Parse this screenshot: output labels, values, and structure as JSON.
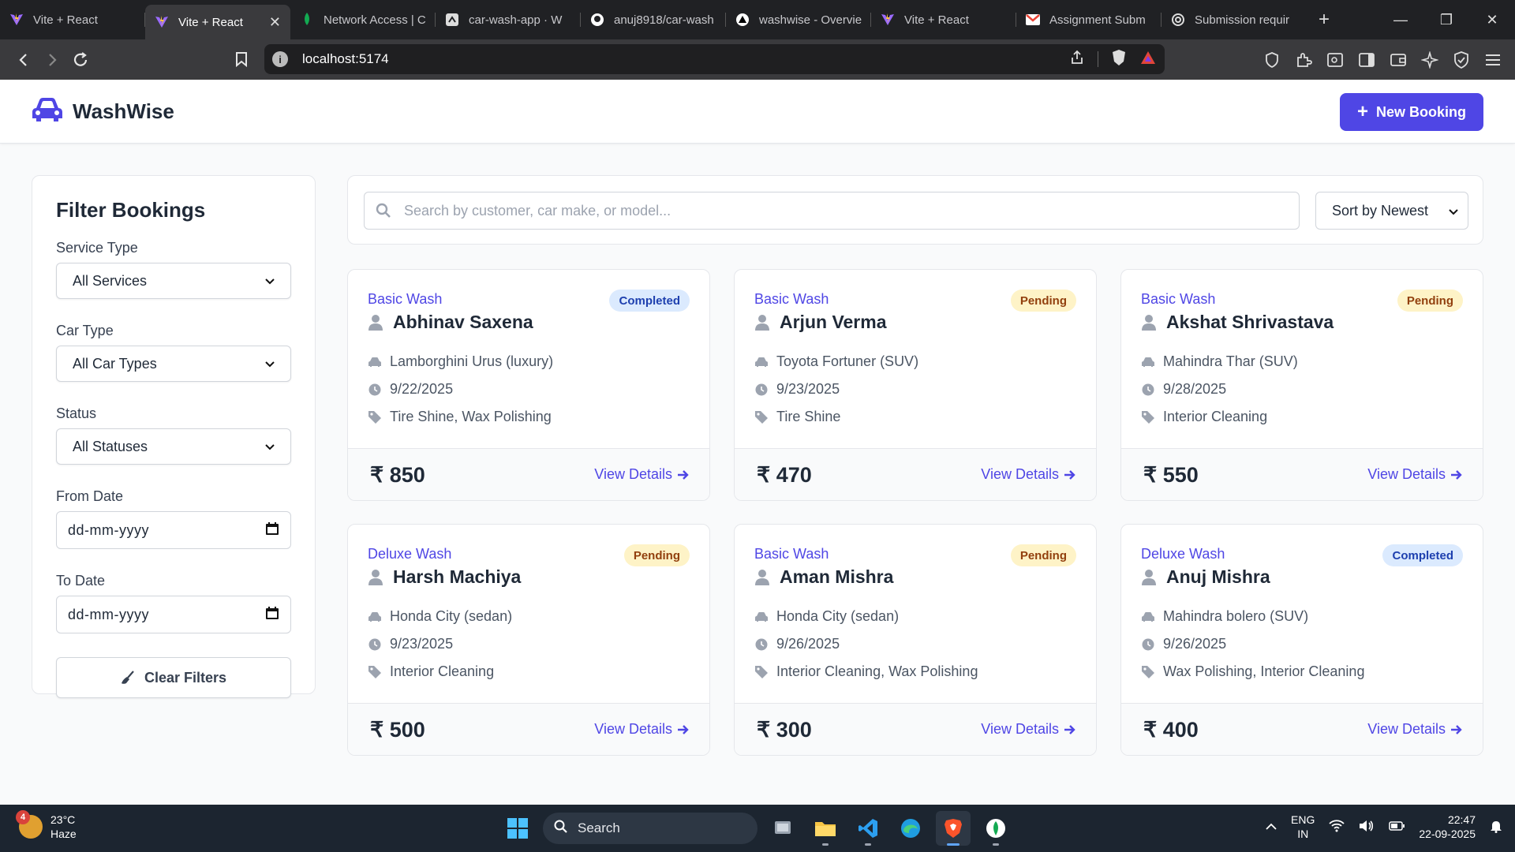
{
  "browser": {
    "tabs": [
      {
        "title": "Vite + React",
        "favicon": "vite-icon",
        "active": false
      },
      {
        "title": "Vite + React",
        "favicon": "vite-icon",
        "active": true
      },
      {
        "title": "Network Access | C",
        "favicon": "mongodb-leaf-icon",
        "active": false
      },
      {
        "title": "car-wash-app · W",
        "favicon": "render-icon",
        "active": false
      },
      {
        "title": "anuj8918/car-wash",
        "favicon": "github-icon",
        "active": false
      },
      {
        "title": "washwise - Overvie",
        "favicon": "vercel-icon",
        "active": false
      },
      {
        "title": "Vite + React",
        "favicon": "vite-icon",
        "active": false
      },
      {
        "title": "Assignment Subm",
        "favicon": "gmail-icon",
        "active": false
      },
      {
        "title": "Submission requir",
        "favicon": "chatgpt-icon",
        "active": false
      }
    ],
    "url": "localhost:5174"
  },
  "app": {
    "name": "WashWise",
    "new_booking_label": "New Booking",
    "accent": "#4f46e5"
  },
  "filters": {
    "title": "Filter Bookings",
    "service_type": {
      "label": "Service Type",
      "value": "All Services"
    },
    "car_type": {
      "label": "Car Type",
      "value": "All Car Types"
    },
    "status": {
      "label": "Status",
      "value": "All Statuses"
    },
    "from_date": {
      "label": "From Date",
      "placeholder": "dd-mm-yyyy"
    },
    "to_date": {
      "label": "To Date",
      "placeholder": "dd-mm-yyyy"
    },
    "clear_label": "Clear Filters"
  },
  "search": {
    "placeholder": "Search by customer, car make, or model...",
    "sort_value": "Sort by Newest"
  },
  "bookings": [
    {
      "service": "Basic Wash",
      "status": "Completed",
      "customer": "Abhinav Saxena",
      "car": "Lamborghini Urus (luxury)",
      "date": "9/22/2025",
      "addons": "Tire Shine, Wax Polishing",
      "price": "850",
      "link": "View Details"
    },
    {
      "service": "Basic Wash",
      "status": "Pending",
      "customer": "Arjun Verma",
      "car": "Toyota Fortuner (SUV)",
      "date": "9/23/2025",
      "addons": "Tire Shine",
      "price": "470",
      "link": "View Details"
    },
    {
      "service": "Basic Wash",
      "status": "Pending",
      "customer": "Akshat Shrivastava",
      "car": "Mahindra Thar (SUV)",
      "date": "9/28/2025",
      "addons": "Interior Cleaning",
      "price": "550",
      "link": "View Details"
    },
    {
      "service": "Deluxe Wash",
      "status": "Pending",
      "customer": "Harsh Machiya",
      "car": "Honda City (sedan)",
      "date": "9/23/2025",
      "addons": "Interior Cleaning",
      "price": "500",
      "link": "View Details"
    },
    {
      "service": "Basic Wash",
      "status": "Pending",
      "customer": "Aman Mishra",
      "car": "Honda City (sedan)",
      "date": "9/26/2025",
      "addons": "Interior Cleaning, Wax Polishing",
      "price": "300",
      "link": "View Details"
    },
    {
      "service": "Deluxe Wash",
      "status": "Completed",
      "customer": "Anuj Mishra",
      "car": "Mahindra bolero (SUV)",
      "date": "9/26/2025",
      "addons": "Wax Polishing, Interior Cleaning",
      "price": "400",
      "link": "View Details"
    }
  ],
  "currency_symbol": "₹",
  "taskbar": {
    "temperature": "23°C",
    "weather": "Haze",
    "weather_badge": "4",
    "search_label": "Search",
    "lang_top": "ENG",
    "lang_bottom": "IN",
    "time": "22:47",
    "date": "22-09-2025"
  }
}
